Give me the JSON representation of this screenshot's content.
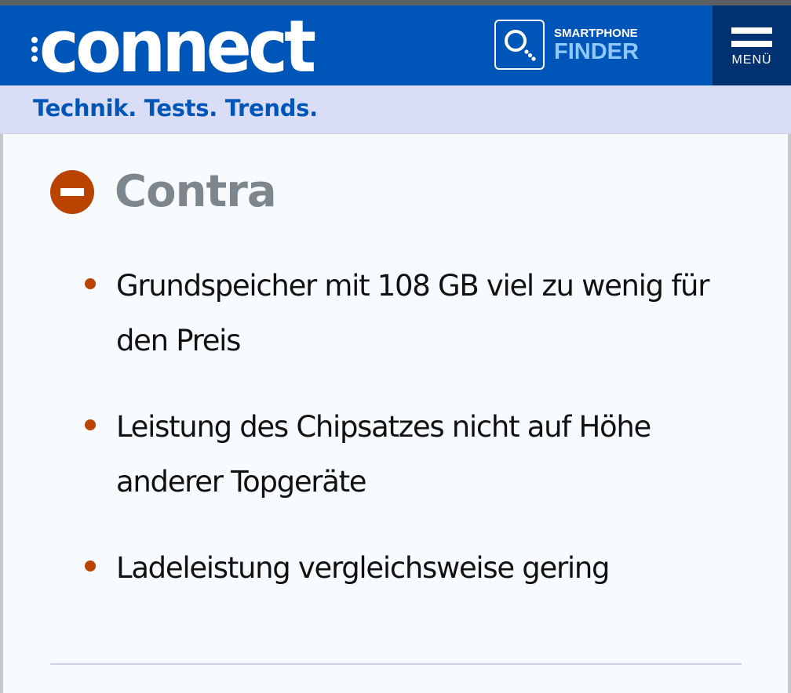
{
  "header": {
    "logo": "connect",
    "finder_small": "SMARTPHONE",
    "finder_big": "FINDER",
    "menu_label": "MENÜ"
  },
  "tagline": "Technik. Tests. Trends.",
  "contra": {
    "title": "Contra",
    "items": [
      "Grundspeicher mit 108 GB viel zu wenig für den Preis",
      "Leistung des Chipsatzes nicht auf Höhe anderer Topgeräte",
      "Ladeleistung vergleichsweise gering"
    ]
  },
  "colors": {
    "brand_blue": "#0055b8",
    "menu_dark_blue": "#003271",
    "tagline_bg": "#d9def6",
    "contra_accent": "#bb4300",
    "contra_title": "#7d858d"
  },
  "icons": {
    "logo_dots": "logo-dots-icon",
    "finder": "search-icon",
    "menu": "hamburger-menu-icon",
    "contra": "minus-circle-icon",
    "bullet": "bullet-dot-icon"
  }
}
